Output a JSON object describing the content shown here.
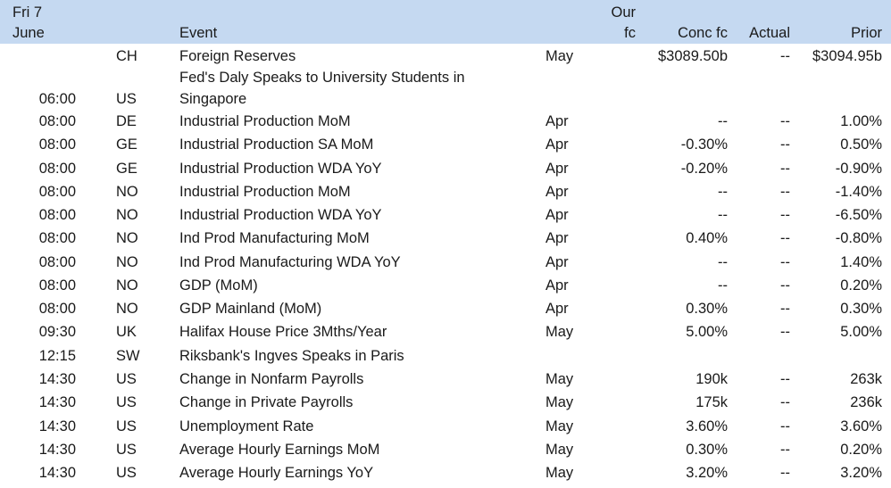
{
  "header": {
    "date_line1": "Fri 7",
    "date_line2": "June",
    "event": "Event",
    "our_fc_line1": "Our",
    "our_fc_line2": "fc",
    "conc_fc": "Conc fc",
    "actual": "Actual",
    "prior": "Prior"
  },
  "rows": [
    {
      "time": "",
      "country": "CH",
      "event": "Foreign Reserves",
      "period": "May",
      "conc": "$3089.50b",
      "actual": "--",
      "prior": "$3094.95b"
    },
    {
      "time": "06:00",
      "country": "US",
      "event": "Fed's Daly Speaks to University Students in",
      "event2": "Singapore",
      "period": "",
      "conc": "",
      "actual": "",
      "prior": ""
    },
    {
      "time": "08:00",
      "country": "DE",
      "event": "Industrial Production MoM",
      "period": "Apr",
      "conc": "--",
      "actual": "--",
      "prior": "1.00%"
    },
    {
      "time": "08:00",
      "country": "GE",
      "event": "Industrial Production SA MoM",
      "period": "Apr",
      "conc": "-0.30%",
      "actual": "--",
      "prior": "0.50%"
    },
    {
      "time": "08:00",
      "country": "GE",
      "event": "Industrial Production WDA YoY",
      "period": "Apr",
      "conc": "-0.20%",
      "actual": "--",
      "prior": "-0.90%"
    },
    {
      "time": "08:00",
      "country": "NO",
      "event": "Industrial Production MoM",
      "period": "Apr",
      "conc": "--",
      "actual": "--",
      "prior": "-1.40%"
    },
    {
      "time": "08:00",
      "country": "NO",
      "event": "Industrial Production WDA YoY",
      "period": "Apr",
      "conc": "--",
      "actual": "--",
      "prior": "-6.50%"
    },
    {
      "time": "08:00",
      "country": "NO",
      "event": "Ind Prod Manufacturing MoM",
      "period": "Apr",
      "conc": "0.40%",
      "actual": "--",
      "prior": "-0.80%"
    },
    {
      "time": "08:00",
      "country": "NO",
      "event": "Ind Prod Manufacturing WDA YoY",
      "period": "Apr",
      "conc": "--",
      "actual": "--",
      "prior": "1.40%"
    },
    {
      "time": "08:00",
      "country": "NO",
      "event": "GDP (MoM)",
      "period": "Apr",
      "conc": "--",
      "actual": "--",
      "prior": "0.20%"
    },
    {
      "time": "08:00",
      "country": "NO",
      "event": "GDP Mainland (MoM)",
      "period": "Apr",
      "conc": "0.30%",
      "actual": "--",
      "prior": "0.30%"
    },
    {
      "time": "09:30",
      "country": "UK",
      "event": "Halifax House Price 3Mths/Year",
      "period": "May",
      "conc": "5.00%",
      "actual": "--",
      "prior": "5.00%"
    },
    {
      "time": "12:15",
      "country": "SW",
      "event": "Riksbank's Ingves Speaks in Paris",
      "period": "",
      "conc": "",
      "actual": "",
      "prior": ""
    },
    {
      "time": "14:30",
      "country": "US",
      "event": "Change in Nonfarm Payrolls",
      "period": "May",
      "conc": "190k",
      "actual": "--",
      "prior": "263k"
    },
    {
      "time": "14:30",
      "country": "US",
      "event": "Change in Private Payrolls",
      "period": "May",
      "conc": "175k",
      "actual": "--",
      "prior": "236k"
    },
    {
      "time": "14:30",
      "country": "US",
      "event": "Unemployment Rate",
      "period": "May",
      "conc": "3.60%",
      "actual": "--",
      "prior": "3.60%"
    },
    {
      "time": "14:30",
      "country": "US",
      "event": "Average Hourly Earnings MoM",
      "period": "May",
      "conc": "0.30%",
      "actual": "--",
      "prior": "0.20%"
    },
    {
      "time": "14:30",
      "country": "US",
      "event": "Average Hourly Earnings YoY",
      "period": "May",
      "conc": "3.20%",
      "actual": "--",
      "prior": "3.20%"
    }
  ]
}
